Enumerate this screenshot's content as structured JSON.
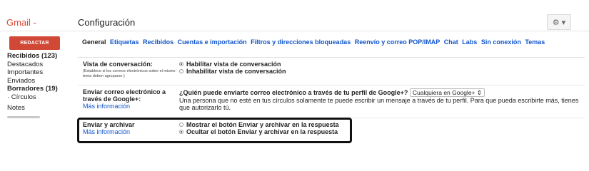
{
  "header": {
    "logo": "Gmail -",
    "title": "Configuración",
    "gear_icon": "gear-icon"
  },
  "compose": {
    "label": "REDACTAR"
  },
  "sidebar": {
    "items": [
      {
        "label": "Recibidos (123)",
        "bold": true
      },
      {
        "label": "Destacados",
        "bold": false
      },
      {
        "label": "Importantes",
        "bold": false
      },
      {
        "label": "Enviados",
        "bold": false
      },
      {
        "label": "Borradores (19)",
        "bold": true
      },
      {
        "label": "· Círculos",
        "bold": false
      },
      {
        "label": "Notes",
        "bold": false
      }
    ]
  },
  "tabs": [
    {
      "label": "General",
      "active": true
    },
    {
      "label": "Etiquetas",
      "active": false
    },
    {
      "label": "Recibidos",
      "active": false
    },
    {
      "label": "Cuentas e importación",
      "active": false
    },
    {
      "label": "Filtros y direcciones bloqueadas",
      "active": false
    },
    {
      "label": "Reenvío y correo POP/IMAP",
      "active": false
    },
    {
      "label": "Chat",
      "active": false
    },
    {
      "label": "Labs",
      "active": false
    },
    {
      "label": "Sin conexión",
      "active": false
    },
    {
      "label": "Temas",
      "active": false
    }
  ],
  "settings": {
    "conversation": {
      "label": "Vista de conversación:",
      "note": "(Establece si los correos electrónicos sobre el mismo tema deben agruparse.)",
      "options": [
        {
          "label": "Habilitar vista de conversación",
          "checked": true
        },
        {
          "label": "Inhabilitar vista de conversación",
          "checked": false
        }
      ]
    },
    "google_plus": {
      "label": "Enviar correo electrónico a través de Google+:",
      "link": "Más información",
      "question": "¿Quién puede enviarte correo electrónico a través de tu perfil de Google+?",
      "select_value": "Cualquiera en Google+ ⇕",
      "description": "Una persona que no esté en tus círculos solamente te puede escribir un mensaje a través de tu perfil. Para que pueda escribirte más, tienes que autorizarlo tú."
    },
    "send_archive": {
      "label": "Enviar y archivar",
      "link": "Más información",
      "options": [
        {
          "label": "Mostrar el botón Enviar y archivar en la respuesta",
          "checked": false
        },
        {
          "label": "Ocultar el botón Enviar y archivar en la respuesta",
          "checked": true
        }
      ]
    }
  }
}
